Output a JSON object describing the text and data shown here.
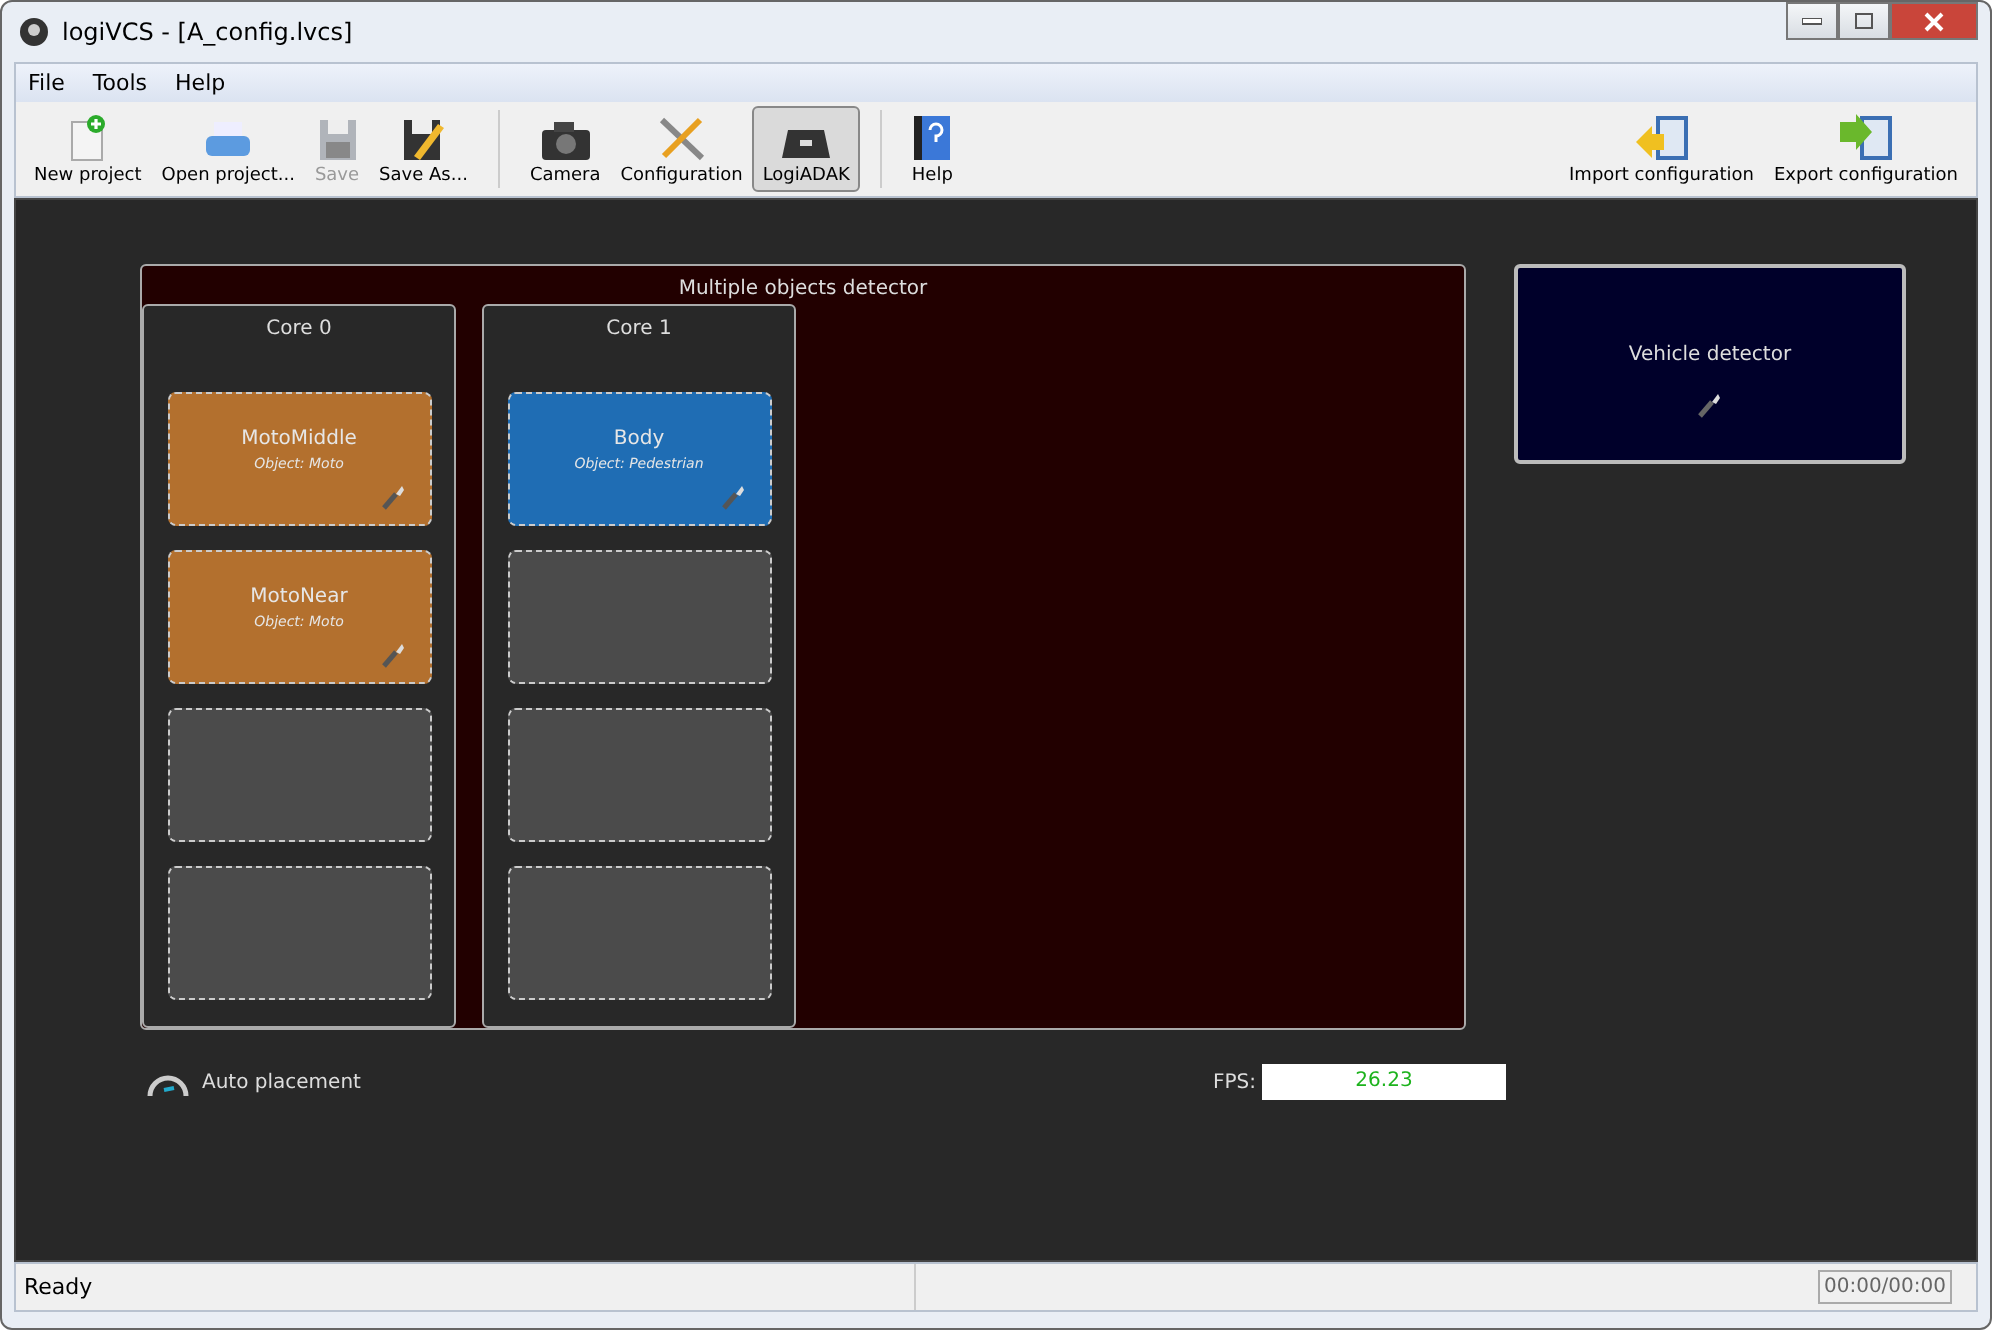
{
  "window": {
    "title": "logiVCS - [A_config.lvcs]"
  },
  "menu": [
    "File",
    "Tools",
    "Help"
  ],
  "toolbar": [
    [
      {
        "label": "New project",
        "disabled": false,
        "selected": false
      },
      {
        "label": "Open project...",
        "disabled": false,
        "selected": false
      },
      {
        "label": "Save",
        "disabled": true,
        "selected": false
      },
      {
        "label": "Save As...",
        "disabled": false,
        "selected": false
      }
    ],
    [
      {
        "label": "Camera",
        "disabled": false,
        "selected": false
      },
      {
        "label": "Configuration",
        "disabled": false,
        "selected": false
      },
      {
        "label": "LogiADAK",
        "disabled": false,
        "selected": true
      }
    ],
    [
      {
        "label": "Help",
        "disabled": false,
        "selected": false
      }
    ]
  ],
  "toolbar_right": [
    {
      "label": "Import configuration"
    },
    {
      "label": "Export configuration"
    }
  ],
  "detector": {
    "title": "Multiple objects detector",
    "cores": [
      {
        "title": "Core 0",
        "slots": [
          {
            "kind": "filled",
            "name": "MotoMiddle",
            "object": "Object: Moto",
            "color": "#b3702e"
          },
          {
            "kind": "filled",
            "name": "MotoNear",
            "object": "Object: Moto",
            "color": "#b3702e"
          },
          {
            "kind": "empty"
          },
          {
            "kind": "empty"
          }
        ]
      },
      {
        "title": "Core 1",
        "slots": [
          {
            "kind": "filled",
            "name": "Body",
            "object": "Object: Pedestrian",
            "color": "#1f6db4"
          },
          {
            "kind": "empty"
          },
          {
            "kind": "empty"
          },
          {
            "kind": "empty"
          }
        ]
      }
    ]
  },
  "vehicle_detector": {
    "title": "Vehicle detector"
  },
  "auto_placement": "Auto placement",
  "fps": {
    "label": "FPS:",
    "value": "26.23"
  },
  "status_bar": {
    "message": "Ready",
    "time": "00:00/00:00"
  }
}
